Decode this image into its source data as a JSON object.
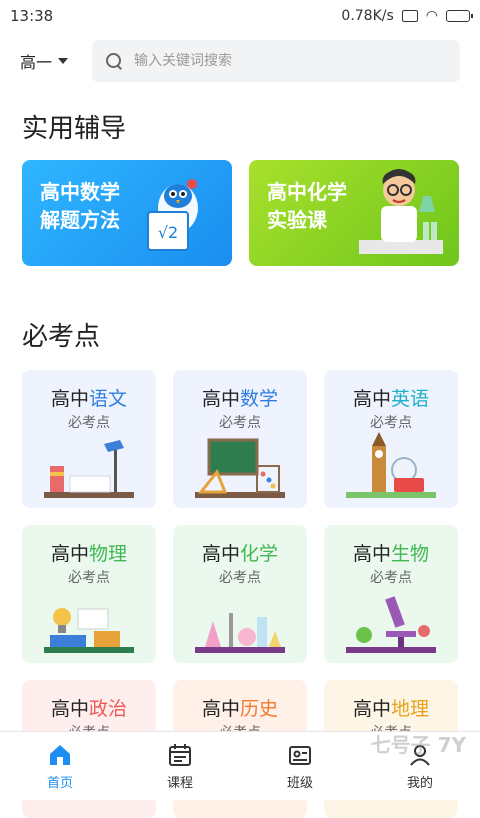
{
  "status": {
    "time": "13:38",
    "speed": "0.78K/s"
  },
  "topbar": {
    "grade": "高一",
    "search_placeholder": "输入关键词搜索"
  },
  "sections": {
    "tutoring_title": "实用辅导",
    "exam_points_title": "必考点"
  },
  "tutoring": [
    {
      "label": "高中数学\n解题方法",
      "color": "#1a9cf5"
    },
    {
      "label": "高中化学\n实验课",
      "color": "#7dcf22"
    }
  ],
  "subjects": [
    {
      "prefix": "高中",
      "name": "语文",
      "name_color": "#2f7de1",
      "sub": "必考点"
    },
    {
      "prefix": "高中",
      "name": "数学",
      "name_color": "#2f7de1",
      "sub": "必考点"
    },
    {
      "prefix": "高中",
      "name": "英语",
      "name_color": "#1bb1c9",
      "sub": "必考点"
    },
    {
      "prefix": "高中",
      "name": "物理",
      "name_color": "#3fb84f",
      "sub": "必考点"
    },
    {
      "prefix": "高中",
      "name": "化学",
      "name_color": "#3fb84f",
      "sub": "必考点"
    },
    {
      "prefix": "高中",
      "name": "生物",
      "name_color": "#3fb84f",
      "sub": "必考点"
    },
    {
      "prefix": "高中",
      "name": "政治",
      "name_color": "#ef5a55",
      "sub": "必考点"
    },
    {
      "prefix": "高中",
      "name": "历史",
      "name_color": "#f07b2f",
      "sub": "必考点"
    },
    {
      "prefix": "高中",
      "name": "地理",
      "name_color": "#e9a21a",
      "sub": "必考点"
    }
  ],
  "tabs": [
    {
      "label": "首页",
      "icon": "home-icon",
      "active": true
    },
    {
      "label": "课程",
      "icon": "calendar-icon",
      "active": false
    },
    {
      "label": "班级",
      "icon": "id-card-icon",
      "active": false
    },
    {
      "label": "我的",
      "icon": "user-icon",
      "active": false
    }
  ],
  "watermark": "七号子 7Y"
}
